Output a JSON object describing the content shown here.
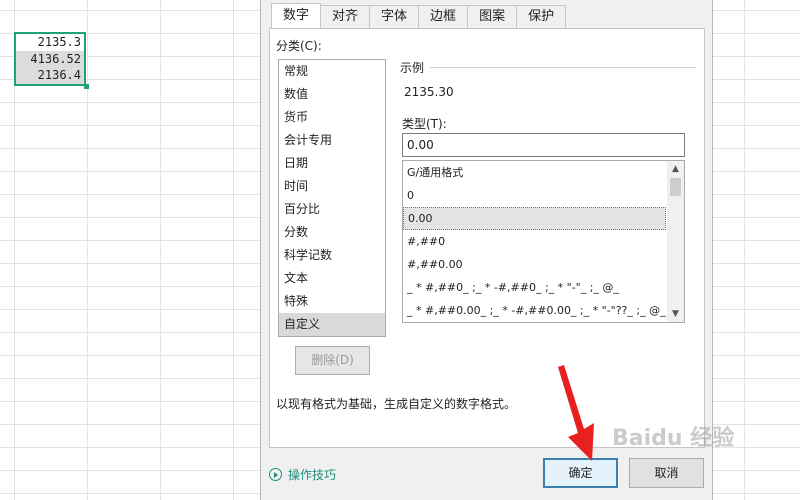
{
  "sheet": {
    "cells": [
      "2135.3",
      "4136.52",
      "2136.4"
    ]
  },
  "dialog": {
    "tabs": [
      {
        "label": "数字",
        "active": true
      },
      {
        "label": "对齐",
        "active": false
      },
      {
        "label": "字体",
        "active": false
      },
      {
        "label": "边框",
        "active": false
      },
      {
        "label": "图案",
        "active": false
      },
      {
        "label": "保护",
        "active": false
      }
    ],
    "category_label": "分类(C):",
    "categories": [
      "常规",
      "数值",
      "货币",
      "会计专用",
      "日期",
      "时间",
      "百分比",
      "分数",
      "科学记数",
      "文本",
      "特殊",
      "自定义"
    ],
    "selected_category": "自定义",
    "delete_label": "删除(D)",
    "sample_label": "示例",
    "sample_value": "2135.30",
    "type_label": "类型(T):",
    "type_value": "0.00",
    "formats": [
      "G/通用格式",
      "0",
      "0.00",
      "#,##0",
      "#,##0.00",
      "_ * #,##0_ ;_ * -#,##0_ ;_ * \"-\"_ ;_ @_",
      "_ * #,##0.00_ ;_ * -#,##0.00_ ;_ * \"-\"??_ ;_ @_"
    ],
    "selected_format": "0.00",
    "description": "以现有格式为基础，生成自定义的数字格式。",
    "tips_label": "操作技巧",
    "ok_label": "确定",
    "cancel_label": "取消"
  },
  "watermark": "Baidu 经验",
  "colors": {
    "cell_border": "#1fa372",
    "link": "#1a8f7a",
    "arrow": "#e8201f",
    "ok_border": "#3c7fb1"
  }
}
